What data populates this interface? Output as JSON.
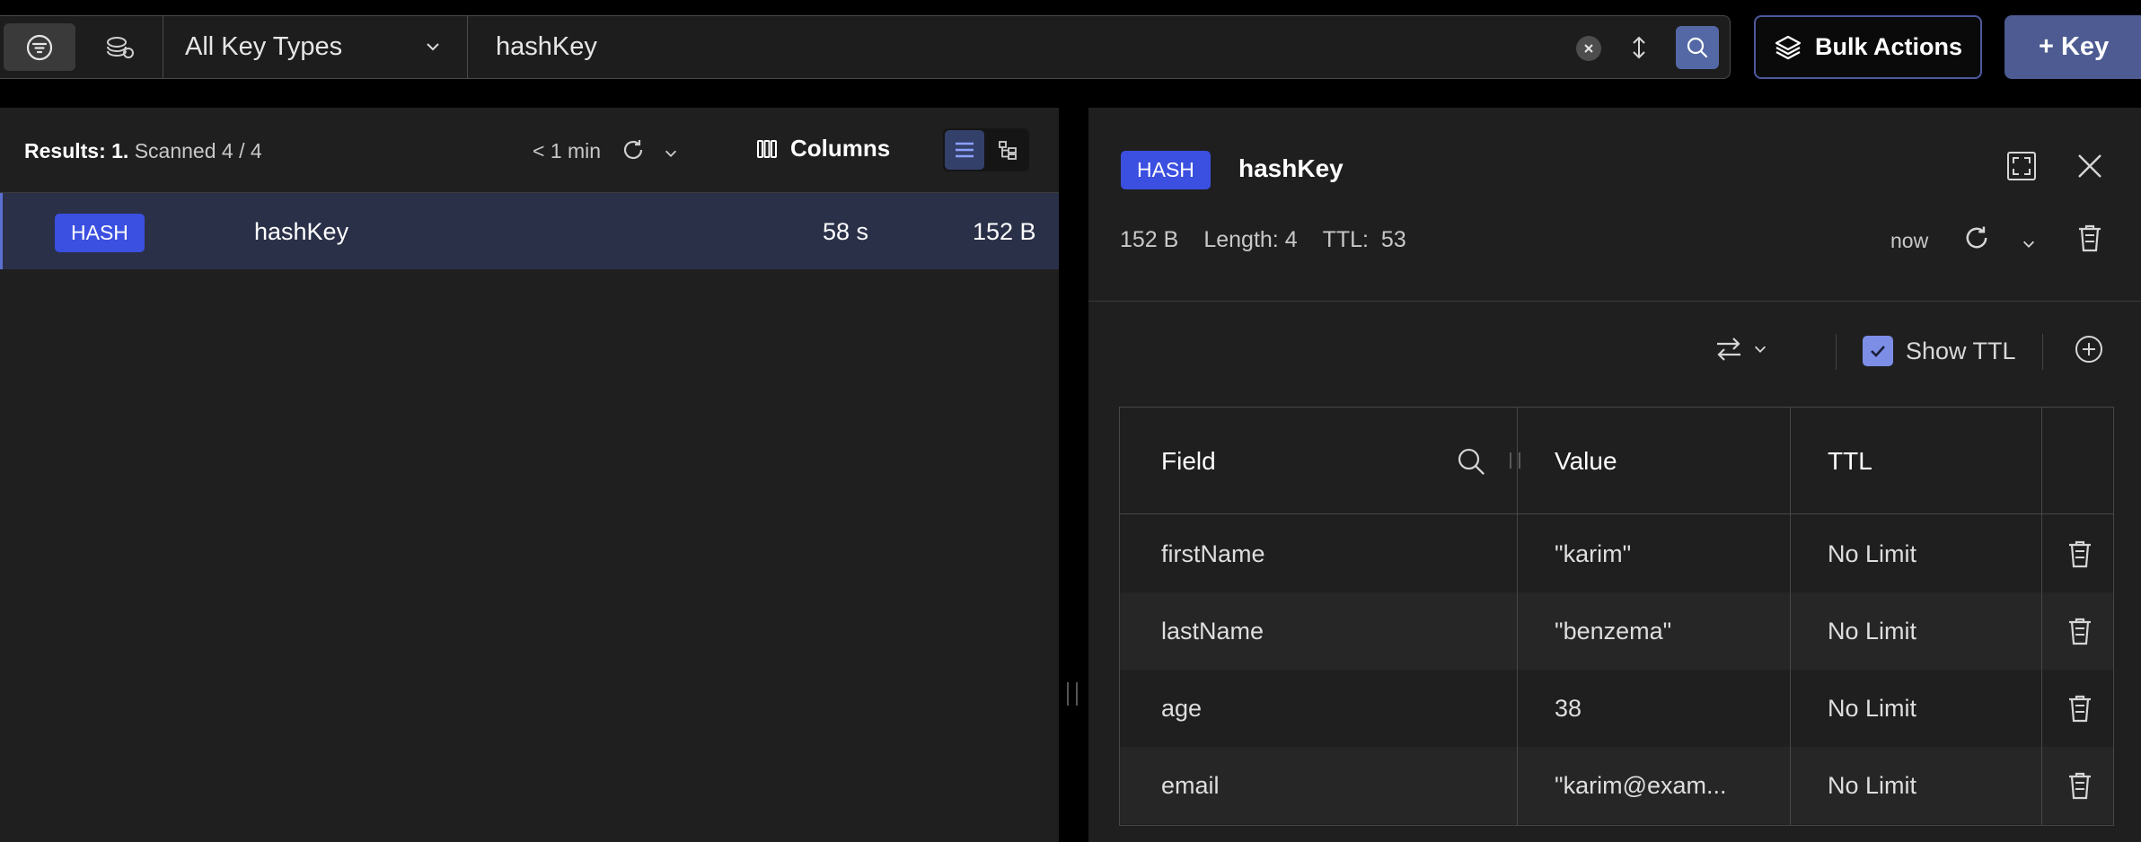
{
  "toolbar": {
    "key_type_filter": "All Key Types",
    "search_value": "hashKey",
    "bulk_actions_label": "Bulk Actions",
    "add_key_label": "+ Key"
  },
  "key_list": {
    "results_label": "Results: 1.",
    "scanned_label": "Scanned 4 / 4",
    "last_refresh": "< 1 min",
    "columns_label": "Columns",
    "rows": [
      {
        "type": "HASH",
        "name": "hashKey",
        "ttl": "58 s",
        "size": "152 B"
      }
    ]
  },
  "details": {
    "type": "HASH",
    "key_name": "hashKey",
    "size": "152 B",
    "length_label": "Length: 4",
    "ttl_label": "TTL:",
    "ttl_value": "53",
    "last_refresh": "now",
    "show_ttl_label": "Show TTL",
    "show_ttl_checked": true,
    "table": {
      "headers": {
        "field": "Field",
        "value": "Value",
        "ttl": "TTL"
      },
      "rows": [
        {
          "field": "firstName",
          "value": "\"karim\"",
          "ttl": "No Limit"
        },
        {
          "field": "lastName",
          "value": "\"benzema\"",
          "ttl": "No Limit"
        },
        {
          "field": "age",
          "value": "38",
          "ttl": "No Limit"
        },
        {
          "field": "email",
          "value": "\"karim@exam...",
          "ttl": "No Limit"
        }
      ]
    }
  },
  "colors": {
    "accent": "#3b4fe0",
    "selected_row": "#2a3048",
    "panel_bg": "#1f1f1f"
  },
  "icons": [
    "filter-icon",
    "stacks-icon",
    "chevron-down-icon",
    "clear-icon",
    "sort-icon",
    "search-icon",
    "layers-icon",
    "refresh-icon",
    "columns-icon",
    "list-view-icon",
    "tree-view-icon",
    "fullscreen-icon",
    "close-icon",
    "trash-icon",
    "swap-icon",
    "check-icon",
    "add-circle-icon"
  ]
}
